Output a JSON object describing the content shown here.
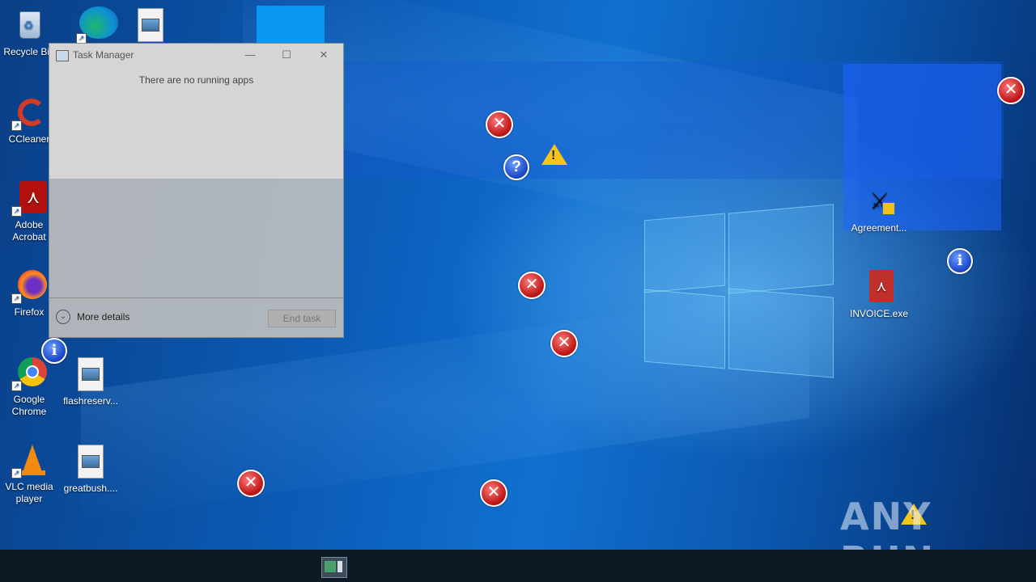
{
  "desktop": {
    "icons": [
      {
        "label": "Recycle Bin",
        "icon": "recycle-bin-icon"
      },
      {
        "label": "CCleaner",
        "icon": "ccleaner-icon"
      },
      {
        "label": "Adobe Acrobat",
        "icon": "pdf-icon"
      },
      {
        "label": "Firefox",
        "icon": "firefox-icon"
      },
      {
        "label": "Google Chrome",
        "icon": "chrome-icon"
      },
      {
        "label": "VLC media player",
        "icon": "vlc-icon"
      },
      {
        "label": "flashreserv...",
        "icon": "image-file-icon"
      },
      {
        "label": "greatbush....",
        "icon": "image-file-icon"
      },
      {
        "label": "Agreement...",
        "icon": "agreement-exe-icon"
      },
      {
        "label": "INVOICE.exe",
        "icon": "invoice-exe-icon"
      }
    ],
    "alert_icons": [
      "error-icon",
      "info-icon",
      "question-icon",
      "warning-icon"
    ]
  },
  "task_manager": {
    "title": "Task Manager",
    "empty_message": "There are no running apps",
    "more_details": "More details",
    "end_task": "End task"
  },
  "watermark": {
    "text": "ANY RUN"
  },
  "colors": {
    "accent": "#0a97f2",
    "taskbar": "#0d1a26"
  }
}
